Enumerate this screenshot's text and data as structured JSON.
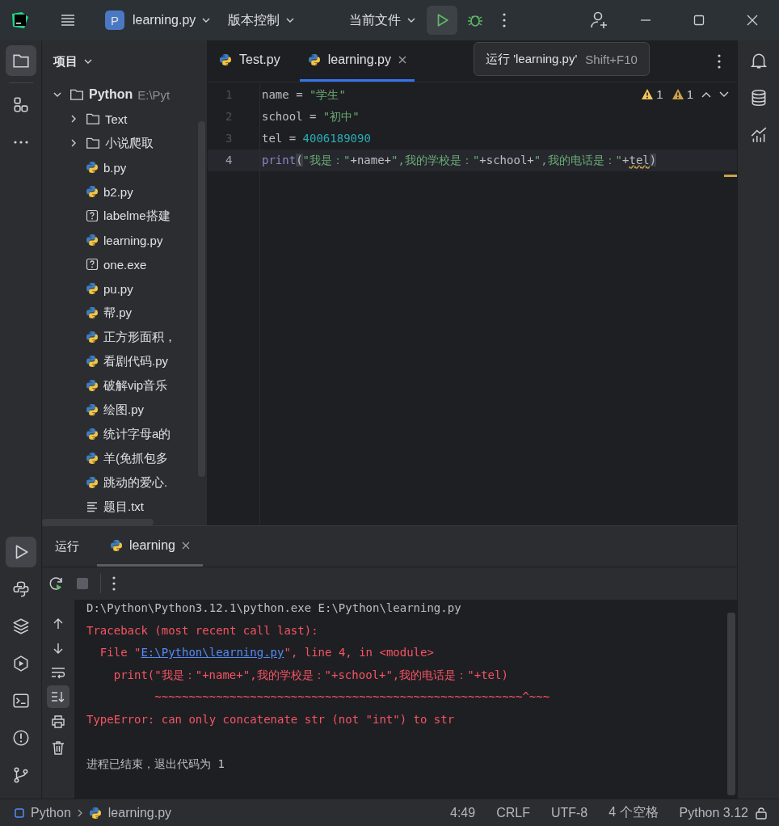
{
  "title_bar": {
    "project_letter": "P",
    "project": "learning.py",
    "vcs": "版本控制",
    "run_config": "当前文件"
  },
  "tooltip": {
    "action": "运行 'learning.py'",
    "shortcut": "Shift+F10"
  },
  "project_panel": {
    "title": "项目",
    "tree": [
      {
        "name": "Python",
        "path": "E:\\Pyt",
        "kind": "folder",
        "expanded": true,
        "children": [
          {
            "name": "Text",
            "kind": "folder",
            "expanded": false
          },
          {
            "name": "小说爬取",
            "kind": "folder",
            "expanded": false
          },
          {
            "name": "b.py",
            "kind": "python"
          },
          {
            "name": "b2.py",
            "kind": "python"
          },
          {
            "name": "labelme搭建",
            "kind": "unknown"
          },
          {
            "name": "learning.py",
            "kind": "python"
          },
          {
            "name": "one.exe",
            "kind": "unknown"
          },
          {
            "name": "pu.py",
            "kind": "python"
          },
          {
            "name": "帮.py",
            "kind": "python"
          },
          {
            "name": "正方形面积，",
            "kind": "python"
          },
          {
            "name": "看剧代码.py",
            "kind": "python"
          },
          {
            "name": "破解vip音乐",
            "kind": "python"
          },
          {
            "name": "绘图.py",
            "kind": "python"
          },
          {
            "name": "统计字母a的",
            "kind": "python"
          },
          {
            "name": "羊(免抓包多",
            "kind": "python"
          },
          {
            "name": "跳动的爱心.",
            "kind": "python"
          },
          {
            "name": "题目.txt",
            "kind": "text"
          }
        ]
      }
    ]
  },
  "editor_tabs": [
    {
      "label": "Test.py",
      "selected": false
    },
    {
      "label": "learning.py",
      "selected": true
    }
  ],
  "inspections": [
    {
      "kind": "warning",
      "count": "1"
    },
    {
      "kind": "weak_warning",
      "count": "1"
    }
  ],
  "code": [
    {
      "number": "1",
      "current": false,
      "tokens": [
        {
          "kind": "ident",
          "text": "name = "
        },
        {
          "kind": "string",
          "text": "\"学生\""
        }
      ]
    },
    {
      "number": "2",
      "current": false,
      "tokens": [
        {
          "kind": "ident",
          "text": "school = "
        },
        {
          "kind": "string",
          "text": "\"初中\""
        }
      ]
    },
    {
      "number": "3",
      "current": false,
      "tokens": [
        {
          "kind": "ident",
          "text": "tel = "
        },
        {
          "kind": "number",
          "text": "4006189090"
        }
      ]
    },
    {
      "number": "4",
      "current": true,
      "tokens": [
        {
          "kind": "builtin",
          "text": "print"
        },
        {
          "kind": "paren",
          "text": "("
        },
        {
          "kind": "string",
          "text": "\"我是：\""
        },
        {
          "kind": "ident",
          "text": "+name+"
        },
        {
          "kind": "string",
          "text": "\",我的学校是：\""
        },
        {
          "kind": "ident",
          "text": "+school+"
        },
        {
          "kind": "string",
          "text": "\",我的电话是：\""
        },
        {
          "kind": "ident",
          "text": "+"
        },
        {
          "kind": "warned",
          "text": "tel"
        },
        {
          "kind": "paren",
          "text": ")"
        }
      ]
    }
  ],
  "run_panel": {
    "title": "运行",
    "tabs": [
      {
        "label": "learning",
        "selected": true
      }
    ],
    "scroll_to_end": true,
    "console": [
      {
        "kind": "command",
        "text": "D:\\Python\\Python3.12.1\\python.exe E:\\Python\\learning.py"
      },
      {
        "kind": "error",
        "text": "Traceback (most recent call last):"
      },
      {
        "kind": "file",
        "text": "  File \"",
        "link": "E:\\Python\\learning.py",
        "after": "\", line 4, in <module>"
      },
      {
        "kind": "error",
        "text": "    print(\"我是：\"+name+\",我的学校是：\"+school+\",我的电话是：\"+tel)"
      },
      {
        "kind": "error",
        "text": "          ~~~~~~~~~~~~~~~~~~~~~~~~~~~~~~~~~~~~~~~~~~~~~~~~~~~~~~^~~~"
      },
      {
        "kind": "error",
        "text": "TypeError: can only concatenate str (not \"int\") to str"
      },
      {
        "kind": "exit",
        "text": "进程已结束，退出代码为 1"
      }
    ]
  },
  "status_bar": {
    "breadcrumbs": [
      {
        "kind": "module",
        "text": "Python"
      },
      {
        "kind": "python",
        "text": "learning.py"
      }
    ],
    "items": [
      "4:49",
      "CRLF",
      "UTF-8",
      "4 个空格",
      "Python 3.12"
    ]
  }
}
